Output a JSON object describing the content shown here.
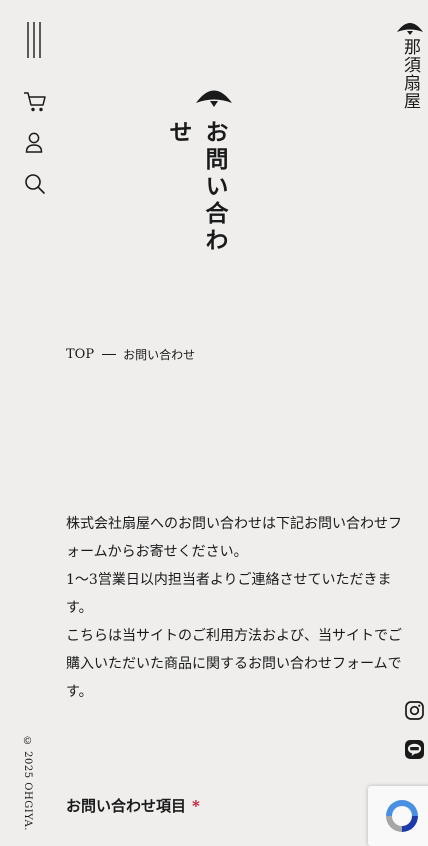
{
  "brand": {
    "logo_text": "那須扇屋"
  },
  "nav": {
    "menu_icon": "menu-icon",
    "cart_icon": "cart-icon",
    "account_icon": "user-icon",
    "search_icon": "search-icon"
  },
  "page": {
    "title": "お問い合わせ"
  },
  "breadcrumb": {
    "home": "TOP",
    "current": "お問い合わせ"
  },
  "intro": {
    "lines": [
      "株式会社扇屋へのお問い合わせは下記お問い合わせフ",
      "ォームからお寄せください。",
      "1〜3営業日以内担当者よりご連絡させていただきま",
      "す。",
      "こちらは当サイトのご利用方法および、当サイトでご",
      "購入いただいた商品に関するお問い合わせフォームで",
      "す。"
    ]
  },
  "form": {
    "field_label": "お問い合わせ項目",
    "required_mark": "*"
  },
  "social": {
    "instagram_icon": "instagram-icon",
    "line_icon": "line-icon"
  },
  "footer": {
    "copyright": "© 2025 OHGIYA."
  },
  "colors": {
    "background": "#efeeed",
    "text": "#1a1a1a",
    "required": "#c0152a"
  }
}
